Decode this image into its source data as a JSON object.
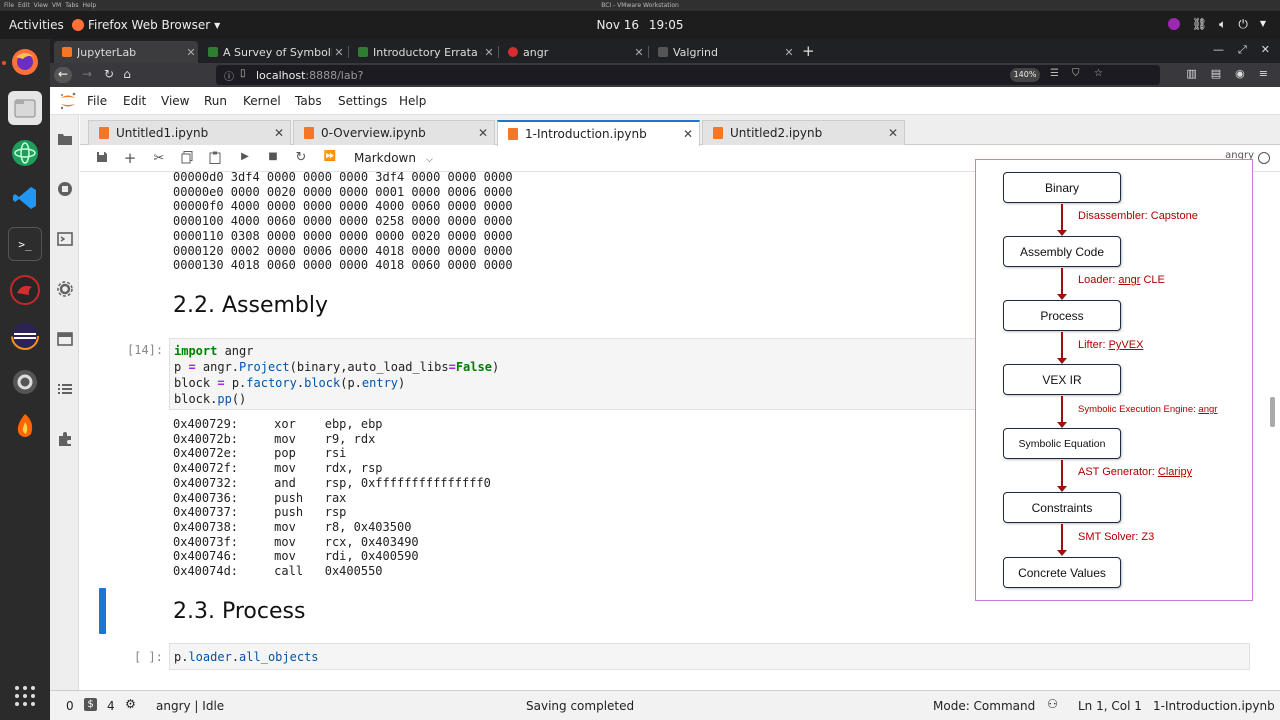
{
  "vm": {
    "menu": [
      "File",
      "Edit",
      "View",
      "VM",
      "Tabs",
      "Help"
    ],
    "title": "BCI - VMware Workstation"
  },
  "topbar": {
    "activities": "Activities",
    "app_menu": "Firefox Web Browser",
    "date": "Nov 16",
    "time": "19:05"
  },
  "browser": {
    "tabs": [
      {
        "label": "JupyterLab",
        "active": true,
        "favicon_color": "#f37726"
      },
      {
        "label": "A Survey of Symbolic Exe",
        "active": false,
        "favicon_color": "#2e7d32"
      },
      {
        "label": "Introductory Errata - angr",
        "active": false,
        "favicon_color": "#2e7d32"
      },
      {
        "label": "angr",
        "active": false,
        "favicon_color": "#d32f2f"
      },
      {
        "label": "Valgrind",
        "active": false,
        "favicon_color": "#555555"
      }
    ],
    "new_tab": "+",
    "url_host": "localhost",
    "url_path": ":8888/lab?",
    "zoom": "140%"
  },
  "jupyter": {
    "menu": [
      "File",
      "Edit",
      "View",
      "Run",
      "Kernel",
      "Tabs",
      "Settings",
      "Help"
    ],
    "doc_tabs": [
      {
        "label": "Untitled1.ipynb",
        "active": false
      },
      {
        "label": "0-Overview.ipynb",
        "active": false
      },
      {
        "label": "1-Introduction.ipynb",
        "active": true
      },
      {
        "label": "Untitled2.ipynb",
        "active": false
      }
    ],
    "cell_type": "Markdown",
    "kernel_name": "angry",
    "hexdump": [
      "00000d0 3df4 0000 0000 0000 3df4 0000 0000 0000",
      "00000e0 0000 0020 0000 0000 0001 0000 0006 0000",
      "00000f0 4000 0000 0000 0000 4000 0060 0000 0000",
      "0000100 4000 0060 0000 0000 0258 0000 0000 0000",
      "0000110 0308 0000 0000 0000 0000 0020 0000 0000",
      "0000120 0002 0000 0006 0000 4018 0000 0000 0000",
      "0000130 4018 0060 0000 0000 4018 0060 0000 0000"
    ],
    "heading_assembly": "2.2. Assembly",
    "cell14_prompt": "[14]:",
    "code": {
      "kw_import": "import",
      "mod": " angr",
      "l2_a": "p ",
      "eq": "=",
      "l2_b": " angr.",
      "l2_fn": "Project",
      "l2_c": "(binary,auto_load_libs",
      "l2_d": "False",
      "l2_e": ")",
      "l3_a": "block ",
      "l3_b": " p.",
      "l3_fn": "factory",
      "l3_c": ".",
      "l3_fn2": "block",
      "l3_d": "(p.",
      "l3_attr": "entry",
      "l3_e": ")",
      "l4_a": "block.",
      "l4_fn": "pp",
      "l4_b": "()"
    },
    "assembly": [
      "0x400729:     xor    ebp, ebp",
      "0x40072b:     mov    r9, rdx",
      "0x40072e:     pop    rsi",
      "0x40072f:     mov    rdx, rsp",
      "0x400732:     and    rsp, 0xfffffffffffffff0",
      "0x400736:     push   rax",
      "0x400737:     push   rsp",
      "0x400738:     mov    r8, 0x403500",
      "0x40073f:     mov    rcx, 0x403490",
      "0x400746:     mov    rdi, 0x400590",
      "0x40074d:     call   0x400550"
    ],
    "heading_process": "2.3. Process",
    "cell_empty_prompt": "[ ]:",
    "cell_empty_code_a": "p.",
    "cell_empty_code_b": "loader",
    "cell_empty_code_c": ".",
    "cell_empty_code_d": "all_objects"
  },
  "diagram": {
    "nodes": [
      "Binary",
      "Assembly Code",
      "Process",
      "VEX IR",
      "Symbolic Equation",
      "Constraints",
      "Concrete Values"
    ],
    "edges": [
      {
        "prefix": "Disassembler: ",
        "tool": "Capstone",
        "underline": false
      },
      {
        "prefix": "Loader: ",
        "tool": "angr",
        "suffix": " CLE",
        "underline": true
      },
      {
        "prefix": "Lifter: ",
        "tool": "PyVEX",
        "underline": true
      },
      {
        "prefix": "Symbolic Execution Engine: ",
        "tool": "angr",
        "underline": true
      },
      {
        "prefix": "AST Generator: ",
        "tool": "Claripy",
        "underline": true
      },
      {
        "prefix": "SMT Solver: ",
        "tool": "Z3",
        "underline": false
      }
    ]
  },
  "status": {
    "count_a": "0",
    "count_b": "4",
    "kernel": "angry | Idle",
    "message": "Saving completed",
    "mode": "Mode: Command",
    "position": "Ln 1, Col 1",
    "file": "1-Introduction.ipynb"
  }
}
